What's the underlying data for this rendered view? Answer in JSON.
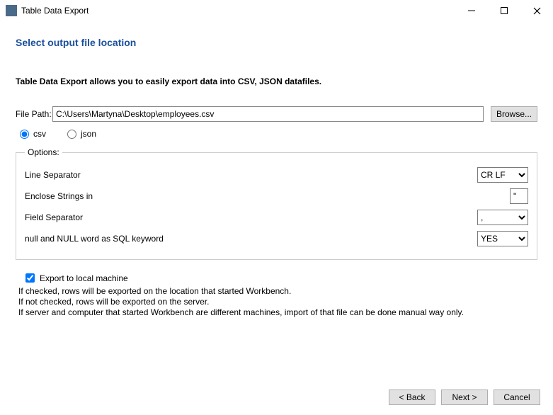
{
  "window": {
    "title": "Table Data Export"
  },
  "heading": "Select output file location",
  "subheading": "Table Data Export allows you to easily export data into CSV, JSON datafiles.",
  "filePath": {
    "label": "File Path:",
    "value": "C:\\Users\\Martyna\\Desktop\\employees.csv",
    "browse": "Browse..."
  },
  "format": {
    "csv": "csv",
    "json": "json",
    "selected": "csv"
  },
  "options": {
    "legend": "Options:",
    "lineSeparator": {
      "label": "Line Separator",
      "value": "CR LF"
    },
    "encloseStrings": {
      "label": "Enclose Strings in",
      "value": "\""
    },
    "fieldSeparator": {
      "label": "Field Separator",
      "value": ","
    },
    "nullKeyword": {
      "label": "null and NULL word as SQL keyword",
      "value": "YES"
    }
  },
  "exportLocal": {
    "label": "Export to local machine",
    "checked": true,
    "help1": "If checked, rows will be exported on the location that started Workbench.",
    "help2": "If not checked, rows will be exported on the server.",
    "help3": "If server and computer that started Workbench are different machines, import of that file can be done manual way only."
  },
  "buttons": {
    "back": "< Back",
    "next": "Next >",
    "cancel": "Cancel"
  }
}
